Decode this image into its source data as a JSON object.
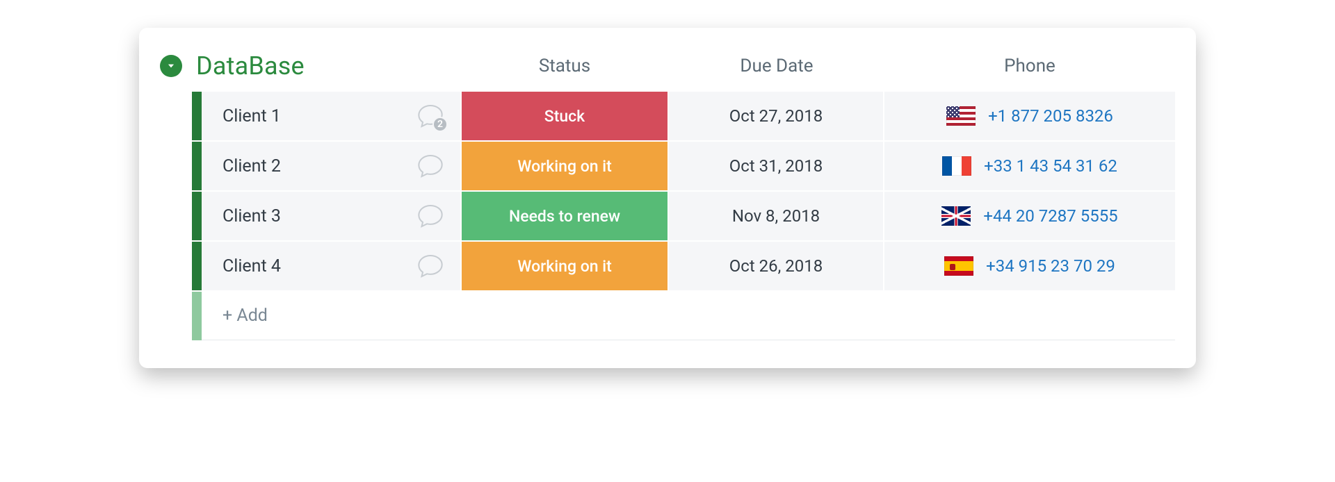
{
  "group": {
    "title": "DataBase",
    "accent": "#2b8a3e"
  },
  "columns": {
    "status": "Status",
    "due_date": "Due Date",
    "phone": "Phone"
  },
  "status_colors": {
    "Stuck": "status-red",
    "Working on it": "status-orange",
    "Needs to renew": "status-green"
  },
  "rows": [
    {
      "name": "Client 1",
      "comments": 2,
      "status": "Stuck",
      "due_date": "Oct 27, 2018",
      "flag": "us",
      "phone": "+1 877 205 8326"
    },
    {
      "name": "Client 2",
      "comments": 0,
      "status": "Working on it",
      "due_date": "Oct 31, 2018",
      "flag": "fr",
      "phone": "+33 1 43 54 31 62"
    },
    {
      "name": "Client 3",
      "comments": 0,
      "status": "Needs to renew",
      "due_date": "Nov 8, 2018",
      "flag": "gb",
      "phone": "+44 20 7287 5555"
    },
    {
      "name": "Client 4",
      "comments": 0,
      "status": "Working on it",
      "due_date": "Oct 26, 2018",
      "flag": "es",
      "phone": "+34 915 23 70 29"
    }
  ],
  "add_label": "+ Add"
}
